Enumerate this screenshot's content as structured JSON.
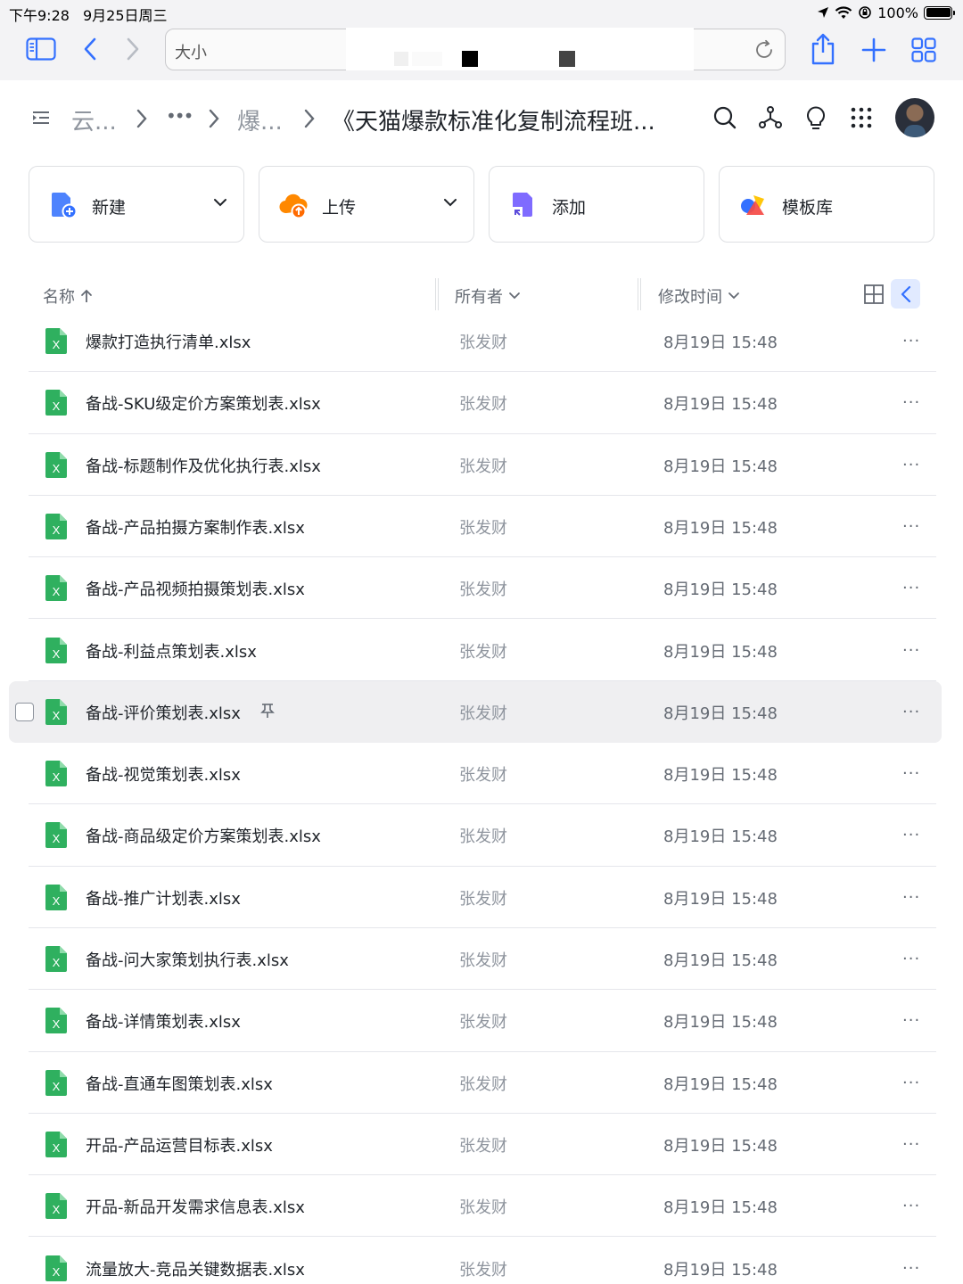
{
  "status_bar": {
    "time": "下午9:28",
    "date": "9月25日周三",
    "battery": "100%"
  },
  "browser": {
    "address_text": "大小"
  },
  "breadcrumb": {
    "root": "云...",
    "ellipsis": "•••",
    "parent": "爆...",
    "current": "《天猫爆款标准化复制流程班..."
  },
  "actions": [
    {
      "label": "新建",
      "icon": "new-doc-icon",
      "has_dropdown": true
    },
    {
      "label": "上传",
      "icon": "upload-cloud-icon",
      "has_dropdown": true
    },
    {
      "label": "添加",
      "icon": "add-shortcut-icon",
      "has_dropdown": false
    },
    {
      "label": "模板库",
      "icon": "template-icon",
      "has_dropdown": false
    }
  ],
  "columns": {
    "name": "名称",
    "owner": "所有者",
    "modified": "修改时间"
  },
  "files": [
    {
      "name": "爆款打造执行清单.xlsx",
      "owner": "张发财",
      "modified": "8月19日 15:48"
    },
    {
      "name": "备战-SKU级定价方案策划表.xlsx",
      "owner": "张发财",
      "modified": "8月19日 15:48"
    },
    {
      "name": "备战-标题制作及优化执行表.xlsx",
      "owner": "张发财",
      "modified": "8月19日 15:48"
    },
    {
      "name": "备战-产品拍摄方案制作表.xlsx",
      "owner": "张发财",
      "modified": "8月19日 15:48"
    },
    {
      "name": "备战-产品视频拍摄策划表.xlsx",
      "owner": "张发财",
      "modified": "8月19日 15:48"
    },
    {
      "name": "备战-利益点策划表.xlsx",
      "owner": "张发财",
      "modified": "8月19日 15:48"
    },
    {
      "name": "备战-评价策划表.xlsx",
      "owner": "张发财",
      "modified": "8月19日 15:48",
      "highlighted": true
    },
    {
      "name": "备战-视觉策划表.xlsx",
      "owner": "张发财",
      "modified": "8月19日 15:48"
    },
    {
      "name": "备战-商品级定价方案策划表.xlsx",
      "owner": "张发财",
      "modified": "8月19日 15:48"
    },
    {
      "name": "备战-推广计划表.xlsx",
      "owner": "张发财",
      "modified": "8月19日 15:48"
    },
    {
      "name": "备战-问大家策划执行表.xlsx",
      "owner": "张发财",
      "modified": "8月19日 15:48"
    },
    {
      "name": "备战-详情策划表.xlsx",
      "owner": "张发财",
      "modified": "8月19日 15:48"
    },
    {
      "name": "备战-直通车图策划表.xlsx",
      "owner": "张发财",
      "modified": "8月19日 15:48"
    },
    {
      "name": "开品-产品运营目标表.xlsx",
      "owner": "张发财",
      "modified": "8月19日 15:48"
    },
    {
      "name": "开品-新品开发需求信息表.xlsx",
      "owner": "张发财",
      "modified": "8月19日 15:48"
    },
    {
      "name": "流量放大-竞品关键数据表.xlsx",
      "owner": "张发财",
      "modified": "8月19日 15:48"
    }
  ],
  "file_icon_letter": "X",
  "more_label": "···",
  "colors": {
    "accent": "#3370ff",
    "excel_green": "#2fb05f",
    "highlight_row": "#efeff1"
  }
}
